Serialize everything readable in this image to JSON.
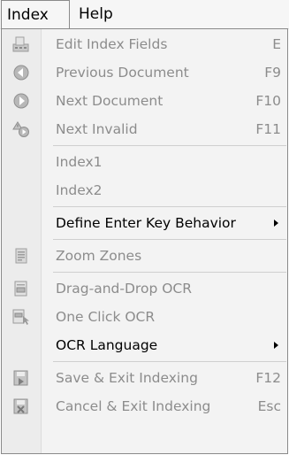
{
  "menubar": {
    "index_label": "Index",
    "help_label": "Help"
  },
  "menu": {
    "items": [
      {
        "label": "Edit Index Fields",
        "shortcut": "E",
        "icon": "edit-fields-icon",
        "enabled": false
      },
      {
        "label": "Previous Document",
        "shortcut": "F9",
        "icon": "previous-icon",
        "enabled": false
      },
      {
        "label": "Next Document",
        "shortcut": "F10",
        "icon": "next-icon",
        "enabled": false
      },
      {
        "label": "Next Invalid",
        "shortcut": "F11",
        "icon": "next-invalid-icon",
        "enabled": false
      },
      {
        "label": "Index1",
        "shortcut": "",
        "icon": "",
        "enabled": false
      },
      {
        "label": "Index2",
        "shortcut": "",
        "icon": "",
        "enabled": false
      },
      {
        "label": "Define Enter Key Behavior",
        "shortcut": "",
        "icon": "",
        "enabled": true,
        "submenu": true
      },
      {
        "label": "Zoom Zones",
        "shortcut": "",
        "icon": "zoom-zones-icon",
        "enabled": false
      },
      {
        "label": "Drag-and-Drop OCR",
        "shortcut": "",
        "icon": "drag-drop-ocr-icon",
        "enabled": false
      },
      {
        "label": "One Click OCR",
        "shortcut": "",
        "icon": "one-click-ocr-icon",
        "enabled": false
      },
      {
        "label": "OCR Language",
        "shortcut": "",
        "icon": "",
        "enabled": true,
        "submenu": true
      },
      {
        "label": "Save & Exit Indexing",
        "shortcut": "F12",
        "icon": "save-exit-icon",
        "enabled": false
      },
      {
        "label": "Cancel & Exit Indexing",
        "shortcut": "Esc",
        "icon": "cancel-exit-icon",
        "enabled": false
      }
    ]
  }
}
